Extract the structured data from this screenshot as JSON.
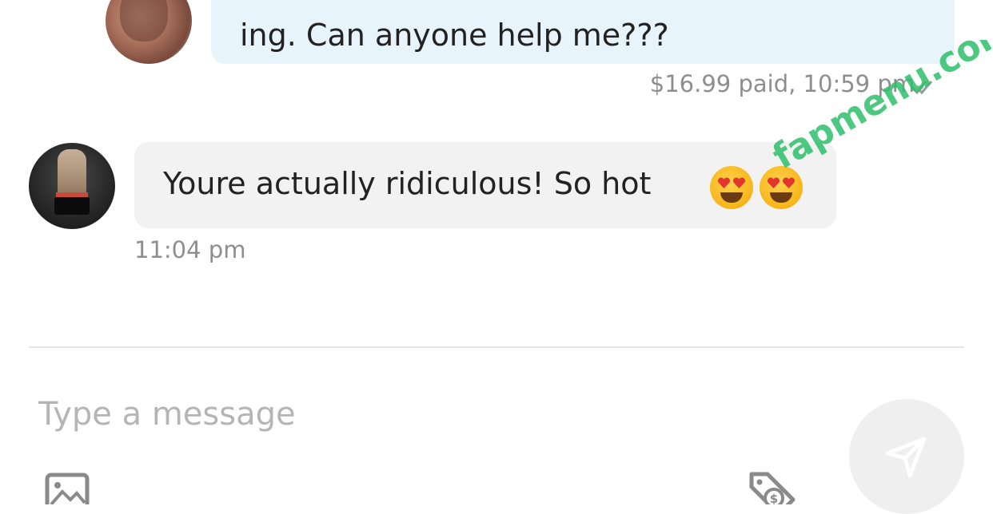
{
  "thread": {
    "outgoing": {
      "text": "ing. Can anyone help me???",
      "meta": "$16.99 paid, 10:59 pm"
    },
    "incoming": {
      "text": "Youre actually ridiculous! So hot",
      "emojis": [
        "heart-eyes-emoji",
        "heart-eyes-emoji"
      ],
      "time": "11:04 pm"
    }
  },
  "composer": {
    "placeholder": "Type a message",
    "value": ""
  },
  "icons": {
    "read_receipt": "double-check-icon",
    "send": "send-icon",
    "media": "image-icon",
    "tip": "price-tag-dollar-icon"
  },
  "watermark": "fapmenu.com",
  "colors": {
    "outgoing_bubble": "#e7f4fc",
    "incoming_bubble": "#f2f2f2",
    "meta_text": "#8e8e8e",
    "placeholder": "#b5b5b5",
    "send_button": "#efefef",
    "watermark": "#2fbf6a"
  }
}
